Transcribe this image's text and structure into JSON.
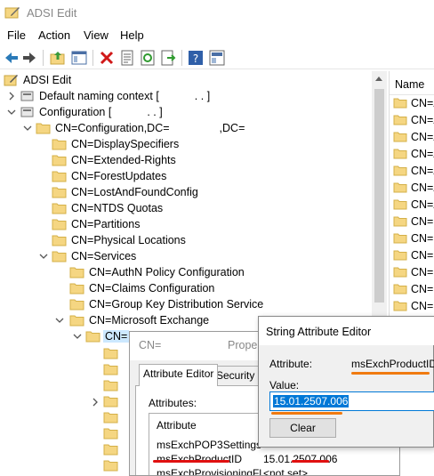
{
  "window": {
    "title": "ADSI Edit"
  },
  "menu": [
    "File",
    "Action",
    "View",
    "Help"
  ],
  "toolbar": {
    "icons": [
      "back-icon",
      "forward-icon",
      "up-folder-icon",
      "show-hide-tree-icon",
      "delete-icon",
      "properties-list-icon",
      "refresh-icon",
      "export-icon",
      "properties-icon",
      "help-icon"
    ]
  },
  "tree": {
    "root": "ADSI Edit",
    "default_naming": "Default naming context [",
    "default_naming_tail": ".    .    ]",
    "configuration": "Configuration [",
    "configuration_tail": ".    .    ]",
    "cn_configuration": "CN=Configuration,DC=",
    "cn_configuration_tail": ",DC=",
    "children": [
      "CN=DisplaySpecifiers",
      "CN=Extended-Rights",
      "CN=ForestUpdates",
      "CN=LostAndFoundConfig",
      "CN=NTDS Quotas",
      "CN=Partitions",
      "CN=Physical Locations",
      "CN=Services"
    ],
    "services_children": [
      "CN=AuthN Policy Configuration",
      "CN=Claims Configuration",
      "CN=Group Key Distribution Service",
      "CN=Microsoft Exchange"
    ],
    "exchange_child": "CN="
  },
  "right_pane": {
    "header": "Name",
    "rows": [
      "CN=A",
      "CN=A",
      "CN=A",
      "CN=A",
      "CN=A",
      "CN=A",
      "CN=A",
      "CN=C",
      "CN=C",
      "CN=E",
      "CN=E",
      "CN=E",
      "CN=F"
    ]
  },
  "properties": {
    "title": "CN=",
    "title_suffix": "Proper",
    "tabs": [
      "Attribute Editor",
      "Security"
    ],
    "attributes_label": "Attributes:",
    "column_attribute": "Attribute",
    "rows": [
      {
        "name": "msExchPOP3Settings",
        "value": ""
      },
      {
        "name": "msExchProductID",
        "value": "15.01.2507.006"
      },
      {
        "name": "msExchProvisioningFl...",
        "value": "<not set>"
      }
    ]
  },
  "string_editor": {
    "title": "String Attribute Editor",
    "attribute_label": "Attribute:",
    "attribute_value": "msExchProductID",
    "value_label": "Value:",
    "value": "15.01.2507.006",
    "clear_label": "Clear"
  },
  "colors": {
    "folder": "#f5d682",
    "selection": "#0078d7",
    "highlight_orange": "#f07a10",
    "highlight_red": "#e01010"
  }
}
